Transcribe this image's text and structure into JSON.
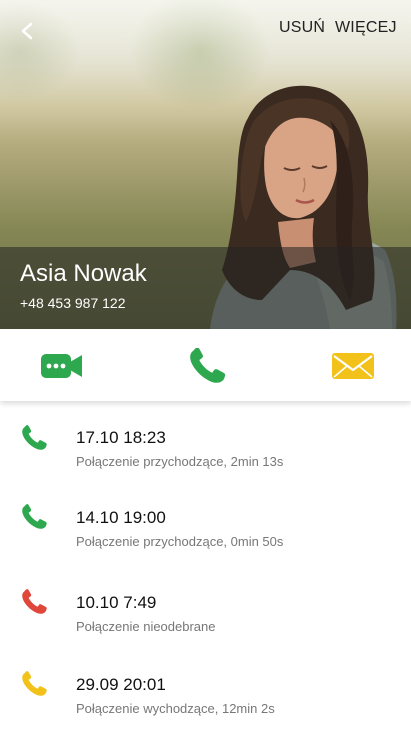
{
  "header": {
    "back_label": "<",
    "delete_label": "USUŃ",
    "more_label": "WIĘCEJ"
  },
  "contact": {
    "name": "Asia Nowak",
    "phone": "+48 453 987 122"
  },
  "actions": [
    {
      "name": "video-call",
      "icon": "video-camera-icon",
      "color": "#2ea84f"
    },
    {
      "name": "voice-call",
      "icon": "phone-icon",
      "color": "#2ea84f"
    },
    {
      "name": "message",
      "icon": "envelope-icon",
      "color": "#f2c21b"
    }
  ],
  "call_history": [
    {
      "datetime": "17.10 18:23",
      "description": "Połączenie przychodzące, 2min 13s",
      "type": "incoming",
      "color": "#2ea84f"
    },
    {
      "datetime": "14.10 19:00",
      "description": "Połączenie przychodzące, 0min 50s",
      "type": "incoming",
      "color": "#2ea84f"
    },
    {
      "datetime": "10.10 7:49",
      "description": "Połączenie nieodebrane",
      "type": "missed",
      "color": "#e0473b"
    },
    {
      "datetime": "29.09 20:01",
      "description": "Połączenie wychodzące, 12min 2s",
      "type": "outgoing",
      "color": "#f2c21b"
    }
  ]
}
